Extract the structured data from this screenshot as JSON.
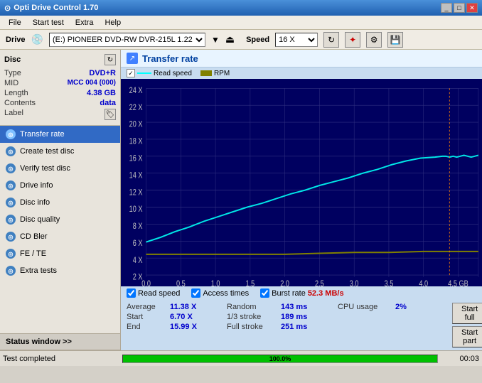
{
  "window": {
    "title": "Opti Drive Control 1.70",
    "icon": "⊙"
  },
  "menu": {
    "items": [
      "File",
      "Start test",
      "Extra",
      "Help"
    ]
  },
  "drive_bar": {
    "drive_label": "Drive",
    "drive_value": "(E:)  PIONEER DVD-RW  DVR-215L 1.22",
    "speed_label": "Speed",
    "speed_value": "16 X"
  },
  "disc": {
    "title": "Disc",
    "type_label": "Type",
    "type_value": "DVD+R",
    "mid_label": "MID",
    "mid_value": "MCC 004 (000)",
    "length_label": "Length",
    "length_value": "4.38 GB",
    "contents_label": "Contents",
    "contents_value": "data",
    "label_label": "Label"
  },
  "nav": {
    "items": [
      {
        "id": "transfer-rate",
        "label": "Transfer rate",
        "active": true
      },
      {
        "id": "create-test-disc",
        "label": "Create test disc",
        "active": false
      },
      {
        "id": "verify-test-disc",
        "label": "Verify test disc",
        "active": false
      },
      {
        "id": "drive-info",
        "label": "Drive info",
        "active": false
      },
      {
        "id": "disc-info",
        "label": "Disc info",
        "active": false
      },
      {
        "id": "disc-quality",
        "label": "Disc quality",
        "active": false
      },
      {
        "id": "cd-bler",
        "label": "CD Bler",
        "active": false
      },
      {
        "id": "fe-te",
        "label": "FE / TE",
        "active": false
      },
      {
        "id": "extra-tests",
        "label": "Extra tests",
        "active": false
      }
    ]
  },
  "status_window": {
    "label": "Status window >>"
  },
  "chart": {
    "title": "Transfer rate",
    "y_labels": [
      "2 X",
      "4 X",
      "6 X",
      "8 X",
      "10 X",
      "12 X",
      "14 X",
      "16 X",
      "18 X",
      "20 X",
      "22 X",
      "24 X"
    ],
    "x_labels": [
      "0.0",
      "0.5",
      "1.0",
      "1.5",
      "2.0",
      "2.5",
      "3.0",
      "3.5",
      "4.0",
      "4.5 GB"
    ],
    "legend": {
      "read_speed_label": "Read speed",
      "rpm_label": "RPM"
    },
    "checkboxes": {
      "read_speed": true,
      "access_times": true,
      "burst_rate": true
    },
    "burst_rate_label": "Burst rate",
    "burst_rate_value": "52.3 MB/s"
  },
  "stats": {
    "average_label": "Average",
    "average_value": "11.38 X",
    "start_label": "Start",
    "start_value": "6.70 X",
    "end_label": "End",
    "end_value": "15.99 X",
    "random_label": "Random",
    "random_value": "143 ms",
    "stroke_1_3_label": "1/3 stroke",
    "stroke_1_3_value": "189 ms",
    "full_stroke_label": "Full stroke",
    "full_stroke_value": "251 ms",
    "cpu_label": "CPU usage",
    "cpu_value": "2%",
    "start_full_btn": "Start full",
    "start_part_btn": "Start part"
  },
  "bottom": {
    "test_completed_label": "Test completed",
    "progress_percent": "100.0%",
    "timer": "00:03"
  }
}
